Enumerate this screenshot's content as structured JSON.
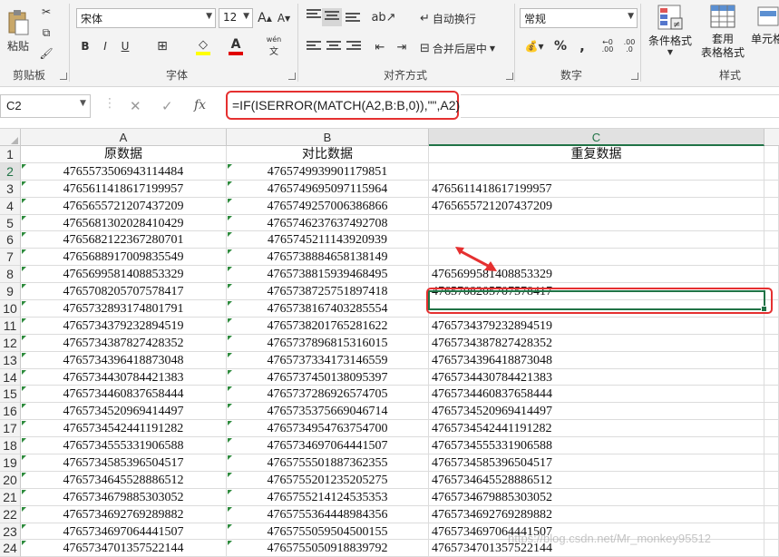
{
  "ribbon": {
    "clipboard": {
      "paste_label": "粘贴",
      "group_label": "剪贴板"
    },
    "font": {
      "font_name": "宋体",
      "font_size": "12",
      "bold": "B",
      "italic": "I",
      "underline": "U",
      "group_label": "字体",
      "wen": "wén"
    },
    "alignment": {
      "wrap_label": "自动换行",
      "merge_label": "合并后居中",
      "group_label": "对齐方式"
    },
    "number": {
      "format": "常规",
      "percent": "%",
      "comma": ",",
      "group_label": "数字",
      "inc_dec": ".00",
      "dec_dec": ".0"
    },
    "styles": {
      "conditional_label": "条件格式",
      "table_label": "套用\n表格格式",
      "cell_label": "单元格",
      "group_label": "样式"
    }
  },
  "formula_bar": {
    "name_box": "C2",
    "formula": "=IF(ISERROR(MATCH(A2,B:B,0)),\"\",A2)",
    "fx": "fx"
  },
  "sheet": {
    "columns": [
      "A",
      "B",
      "C"
    ],
    "selected_cell": "C2",
    "header_row": {
      "a": "原数据",
      "b": "对比数据",
      "c": "重复数据"
    },
    "rows": [
      {
        "n": "2",
        "a": "476557350694311448​4",
        "b": "4765749939901179851",
        "c": ""
      },
      {
        "n": "3",
        "a": "4765611418617199957",
        "b": "4765749695097115964",
        "c": "4765611418617199957"
      },
      {
        "n": "4",
        "a": "4765655721207437209",
        "b": "4765749257006386866",
        "c": "4765655721207437209"
      },
      {
        "n": "5",
        "a": "4765681302028410429",
        "b": "4765746237637492708",
        "c": ""
      },
      {
        "n": "6",
        "a": "4765682122367280701",
        "b": "4765745211143920939",
        "c": ""
      },
      {
        "n": "7",
        "a": "4765688917009835549",
        "b": "4765738884658138149",
        "c": ""
      },
      {
        "n": "8",
        "a": "4765699581408853329",
        "b": "4765738815939468495",
        "c": "4765699581408853329"
      },
      {
        "n": "9",
        "a": "4765708205707578417",
        "b": "4765738725751897418",
        "c": "4765708205707578417"
      },
      {
        "n": "10",
        "a": "4765732893174801791",
        "b": "4765738167403285554",
        "c": ""
      },
      {
        "n": "11",
        "a": "4765734379232894519",
        "b": "4765738201765281622",
        "c": "4765734379232894519"
      },
      {
        "n": "12",
        "a": "4765734387827428352",
        "b": "4765737896815316015",
        "c": "4765734387827428352"
      },
      {
        "n": "13",
        "a": "4765734396418873048",
        "b": "4765737334173146559",
        "c": "4765734396418873048"
      },
      {
        "n": "14",
        "a": "4765734430784421383",
        "b": "4765737450138095397",
        "c": "4765734430784421383"
      },
      {
        "n": "15",
        "a": "4765734460837658444",
        "b": "4765737286926574705",
        "c": "4765734460837658444"
      },
      {
        "n": "16",
        "a": "4765734520969414497",
        "b": "4765735375669046714",
        "c": "4765734520969414497"
      },
      {
        "n": "17",
        "a": "4765734542441191282",
        "b": "4765734954763754700",
        "c": "4765734542441191282"
      },
      {
        "n": "18",
        "a": "4765734555331906588",
        "b": "4765734697064441507",
        "c": "4765734555331906588"
      },
      {
        "n": "19",
        "a": "4765734585396504517",
        "b": "4765755501887362355",
        "c": "4765734585396504517"
      },
      {
        "n": "20",
        "a": "4765734645528886512",
        "b": "4765755201235205275",
        "c": "4765734645528886512"
      },
      {
        "n": "21",
        "a": "4765734679885303052",
        "b": "4765755214124535353",
        "c": "4765734679885303052"
      },
      {
        "n": "22",
        "a": "4765734692769289882",
        "b": "4765755364448984356",
        "c": "4765734692769289882"
      },
      {
        "n": "23",
        "a": "4765734697064441507",
        "b": "4765755059504500155",
        "c": "4765734697064441507"
      },
      {
        "n": "24",
        "a": "4765734701357522144",
        "b": "4765755050918839792",
        "c": "4765734701357522144"
      }
    ]
  },
  "watermark": "https://blog.csdn.net/Mr_monkey95512",
  "colors": {
    "accent": "#217346",
    "highlight": "#e53030"
  }
}
